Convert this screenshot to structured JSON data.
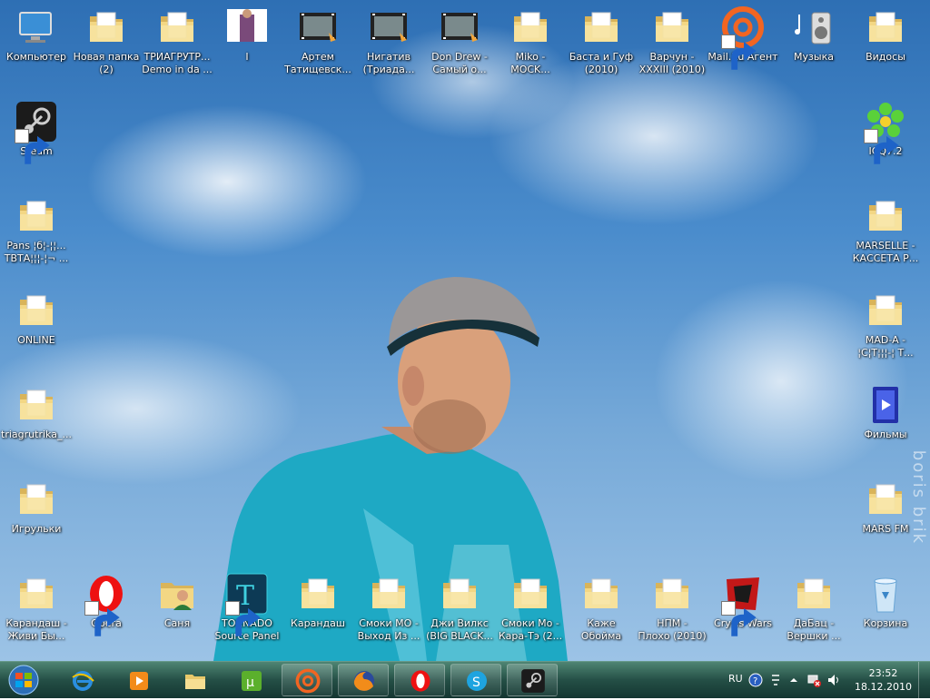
{
  "desktop": {
    "watermark": "boris brik",
    "icons": [
      {
        "label": "Компьютер",
        "icon": "computer-icon"
      },
      {
        "label": "Новая папка\n(2)",
        "icon": "folder-icon"
      },
      {
        "label": "ТРИАГРУТР...\nDemo in da ...",
        "icon": "folder-icon"
      },
      {
        "label": "I",
        "icon": "photo-icon"
      },
      {
        "label": "Артем\nТатищевск...",
        "icon": "video-icon"
      },
      {
        "label": "Нигатив\n(Триада...",
        "icon": "video-icon"
      },
      {
        "label": "Don Drew -\nСамый о...",
        "icon": "video-icon"
      },
      {
        "label": "Miko -\nMOCK...",
        "icon": "folder-icon"
      },
      {
        "label": "Баста и Гуф\n(2010)",
        "icon": "folder-icon"
      },
      {
        "label": "Варчун -\nXXXIII (2010)",
        "icon": "folder-icon"
      },
      {
        "label": "Mail.Ru Агент",
        "icon": "mailru-agent-icon"
      },
      {
        "label": "Музыка",
        "icon": "music-icon"
      },
      {
        "label": "Видосы",
        "icon": "folder-icon"
      },
      {
        "label": "Steam",
        "icon": "steam-icon"
      },
      {
        "label": "ICQ7.2",
        "icon": "icq-icon"
      },
      {
        "label": "Pans ¦б¦-¦¦...\nТВТА¦¦¦-¦¬ ...",
        "icon": "folder-icon"
      },
      {
        "label": "MARSELLE -\nКАССЕТА Р...",
        "icon": "folder-icon"
      },
      {
        "label": "ONLINE",
        "icon": "folder-icon"
      },
      {
        "label": "MAD-A -\n¦С¦Т¦¦¦-¦ Т...",
        "icon": "folder-icon"
      },
      {
        "label": "triagrutrika_...",
        "icon": "folder-icon"
      },
      {
        "label": "Фильмы",
        "icon": "films-icon"
      },
      {
        "label": "Игрульки",
        "icon": "folder-icon"
      },
      {
        "label": "MARS FM",
        "icon": "folder-icon"
      },
      {
        "label": "Карандаш -\nЖиви Бы...",
        "icon": "folder-icon"
      },
      {
        "label": "Opera",
        "icon": "opera-icon"
      },
      {
        "label": "Саня",
        "icon": "user-folder-icon"
      },
      {
        "label": "TORNADO\nSource Panel",
        "icon": "tornado-icon"
      },
      {
        "label": "Карандаш",
        "icon": "folder-icon"
      },
      {
        "label": "Смоки МО -\nВыход Из ...",
        "icon": "folder-icon"
      },
      {
        "label": "Джи Вилкс\n(BIG BLACK...",
        "icon": "folder-icon"
      },
      {
        "label": "Смоки Мо -\nКара-Тэ (2...",
        "icon": "folder-icon"
      },
      {
        "label": "Каже\nОбойма",
        "icon": "folder-icon"
      },
      {
        "label": "НПМ -\nПлохо (2010)",
        "icon": "folder-icon"
      },
      {
        "label": "Crysis Wars",
        "icon": "crysis-icon"
      },
      {
        "label": "ДаБац -\nВершки ...",
        "icon": "folder-icon"
      },
      {
        "label": "Корзина",
        "icon": "recycle-bin-icon"
      }
    ]
  },
  "taskbar": {
    "buttons": [
      {
        "name": "internet-explorer",
        "icon": "ie-icon"
      },
      {
        "name": "media-player",
        "icon": "media-player-icon"
      },
      {
        "name": "explorer",
        "icon": "explorer-icon"
      },
      {
        "name": "utorrent",
        "icon": "utorrent-icon"
      },
      {
        "name": "mailru-agent",
        "icon": "mailru-agent-icon"
      },
      {
        "name": "firefox",
        "icon": "firefox-icon"
      },
      {
        "name": "opera",
        "icon": "opera-icon"
      },
      {
        "name": "skype",
        "icon": "skype-icon"
      },
      {
        "name": "steam",
        "icon": "steam-icon"
      }
    ],
    "tray": {
      "language": "RU",
      "time": "23:52",
      "date": "18.12.2010"
    }
  }
}
